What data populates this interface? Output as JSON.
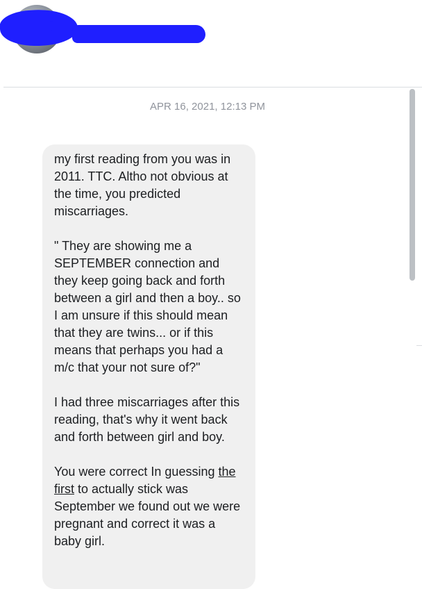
{
  "conversation": {
    "contact_name": "",
    "timestamp": "APR 16, 2021, 12:13 PM"
  },
  "message": {
    "para1": "my first reading from you was in 2011.  TTC.  Altho not obvious at the time, you predicted miscarriages.",
    "para2": "\" They are showing me a SEPTEMBER connection and they keep going back and forth between a  girl and then a boy.. so I am unsure if this should mean that they are twins... or if this means that perhaps you had a m/c that your not sure of?\"",
    "para3": "I had three miscarriages after this reading, that's why it went back and forth between girl and boy.",
    "para4_start": "You were correct In guessing ",
    "para4_underlined": "the first",
    "para4_end": " to actually stick was September we found out we were pregnant and correct it was a baby girl."
  },
  "colors": {
    "bubble_bg": "#f0f0f0",
    "timestamp": "#90949c",
    "redaction": "#1f1fff"
  }
}
